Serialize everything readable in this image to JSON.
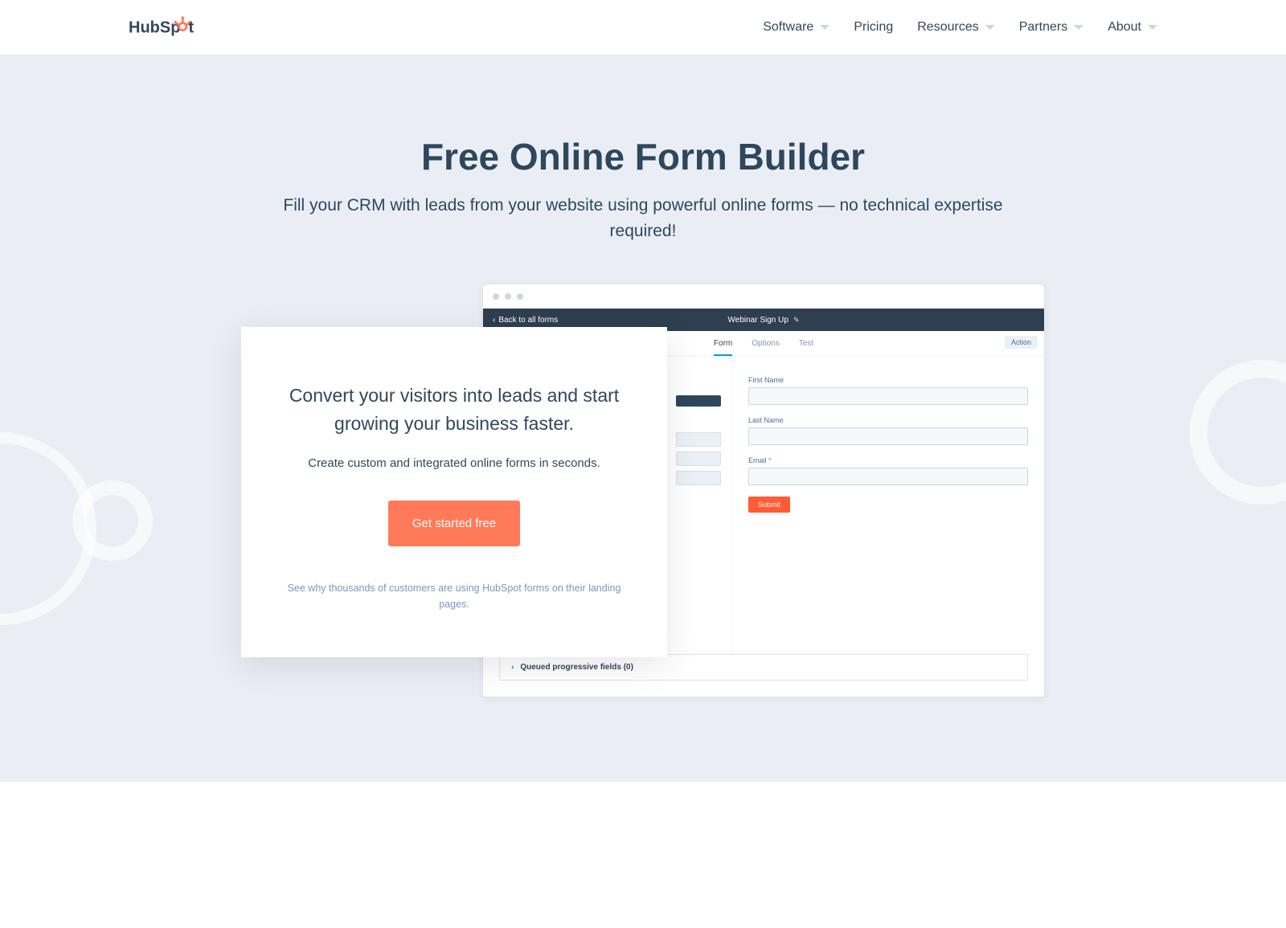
{
  "brand": "HubSpot",
  "nav": {
    "items": [
      {
        "label": "Software",
        "has_dropdown": true
      },
      {
        "label": "Pricing",
        "has_dropdown": false
      },
      {
        "label": "Resources",
        "has_dropdown": true
      },
      {
        "label": "Partners",
        "has_dropdown": true
      },
      {
        "label": "About",
        "has_dropdown": true
      }
    ]
  },
  "hero": {
    "title": "Free Online Form Builder",
    "subtitle": "Fill your CRM with leads from your website using powerful online forms — no technical expertise required!"
  },
  "cta": {
    "heading": "Convert your visitors into leads and start growing your business faster.",
    "subheading": "Create custom and integrated online forms in seconds.",
    "button": "Get started free",
    "footnote": "See why thousands of customers are using HubSpot forms on their landing pages."
  },
  "app_mock": {
    "back_label": "Back to all forms",
    "title": "Webinar Sign Up",
    "tabs": [
      "Form",
      "Options",
      "Test"
    ],
    "active_tab": "Form",
    "action_label": "Action",
    "fields": [
      {
        "label": "First Name",
        "required": false
      },
      {
        "label": "Last Name",
        "required": false
      },
      {
        "label": "Email",
        "required": true
      }
    ],
    "submit_label": "Submit",
    "queued_label": "Queued progressive fields (0)"
  },
  "colors": {
    "accent": "#ff7a59",
    "dark": "#2e475d",
    "page_bg": "#eaeef4"
  }
}
